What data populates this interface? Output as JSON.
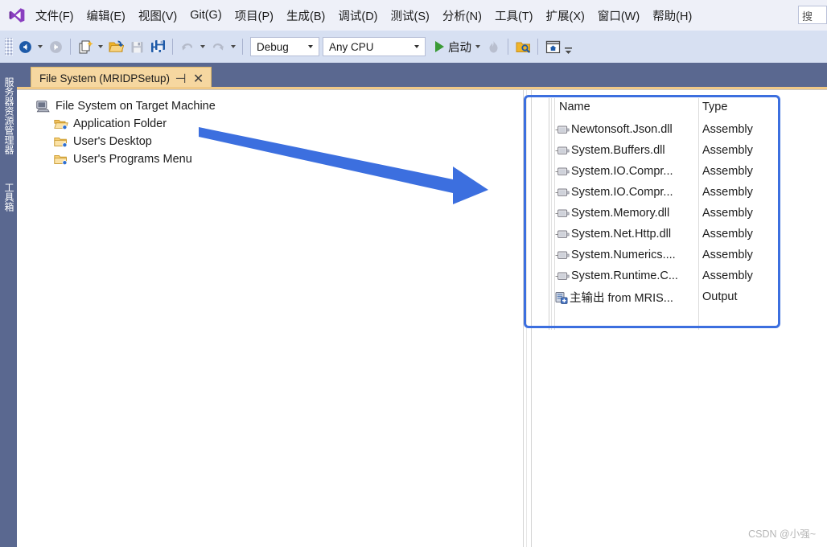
{
  "app": {
    "logo_icon": "visual-studio-logo-icon"
  },
  "menubar": {
    "items": [
      {
        "label": "文件(F)",
        "name": "menu-file"
      },
      {
        "label": "编辑(E)",
        "name": "menu-edit"
      },
      {
        "label": "视图(V)",
        "name": "menu-view"
      },
      {
        "label": "Git(G)",
        "name": "menu-git"
      },
      {
        "label": "项目(P)",
        "name": "menu-project"
      },
      {
        "label": "生成(B)",
        "name": "menu-build"
      },
      {
        "label": "调试(D)",
        "name": "menu-debug"
      },
      {
        "label": "测试(S)",
        "name": "menu-test"
      },
      {
        "label": "分析(N)",
        "name": "menu-analyze"
      },
      {
        "label": "工具(T)",
        "name": "menu-tools"
      },
      {
        "label": "扩展(X)",
        "name": "menu-extensions"
      },
      {
        "label": "窗口(W)",
        "name": "menu-window"
      },
      {
        "label": "帮助(H)",
        "name": "menu-help"
      }
    ],
    "search": {
      "value": "搜",
      "placeholder": "搜索"
    }
  },
  "toolbar": {
    "navigate_back_icon": "navigate-back-icon",
    "navigate_forward_icon": "navigate-forward-icon",
    "new_item_icon": "new-item-icon",
    "open_file_icon": "open-folder-icon",
    "save_icon": "save-icon",
    "save_all_icon": "save-all-icon",
    "undo_icon": "undo-icon",
    "redo_icon": "redo-icon",
    "configuration": "Debug",
    "platform": "Any CPU",
    "run_label": "启动",
    "hot_reload_icon": "hot-reload-flame-icon",
    "find_in_folder_icon": "find-in-folder-icon",
    "preview_icon": "preview-window-icon",
    "overflow_icon": "toolbar-overflow-icon"
  },
  "leftdock": {
    "tabs": [
      {
        "label": "服务器资源管理器",
        "name": "sidebar-tab-server-explorer"
      },
      {
        "label": "工具箱",
        "name": "sidebar-tab-toolbox"
      }
    ]
  },
  "doctab": {
    "title": "File System (MRIDPSetup)",
    "pin_glyph": "⊣",
    "close_glyph": "✕"
  },
  "tree": {
    "root": {
      "label": "File System on Target Machine",
      "icon": "target-machine-icon"
    },
    "children": [
      {
        "label": "Application Folder",
        "icon": "open-folder-icon"
      },
      {
        "label": "User's Desktop",
        "icon": "folder-icon"
      },
      {
        "label": "User's Programs Menu",
        "icon": "folder-icon"
      }
    ]
  },
  "filelist": {
    "columns": [
      "Name",
      "Type"
    ],
    "rows": [
      {
        "name": "Newtonsoft.Json.dll",
        "type": "Assembly",
        "icon": "assembly-icon"
      },
      {
        "name": "System.Buffers.dll",
        "type": "Assembly",
        "icon": "assembly-icon"
      },
      {
        "name": "System.IO.Compr...",
        "type": "Assembly",
        "icon": "assembly-icon"
      },
      {
        "name": "System.IO.Compr...",
        "type": "Assembly",
        "icon": "assembly-icon"
      },
      {
        "name": "System.Memory.dll",
        "type": "Assembly",
        "icon": "assembly-icon"
      },
      {
        "name": "System.Net.Http.dll",
        "type": "Assembly",
        "icon": "assembly-icon"
      },
      {
        "name": "System.Numerics....",
        "type": "Assembly",
        "icon": "assembly-icon"
      },
      {
        "name": "System.Runtime.C...",
        "type": "Assembly",
        "icon": "assembly-icon"
      },
      {
        "name": "主输出 from MRIS...",
        "type": "Output",
        "icon": "project-output-icon"
      }
    ]
  },
  "annotations": {
    "highlight_color": "#3c6fdf",
    "arrow_color": "#3c6fdf",
    "arrow_icon": "pointer-arrow-icon",
    "highlight_icon": "highlight-rectangle-icon"
  },
  "watermark": {
    "text": "CSDN @小强~"
  }
}
